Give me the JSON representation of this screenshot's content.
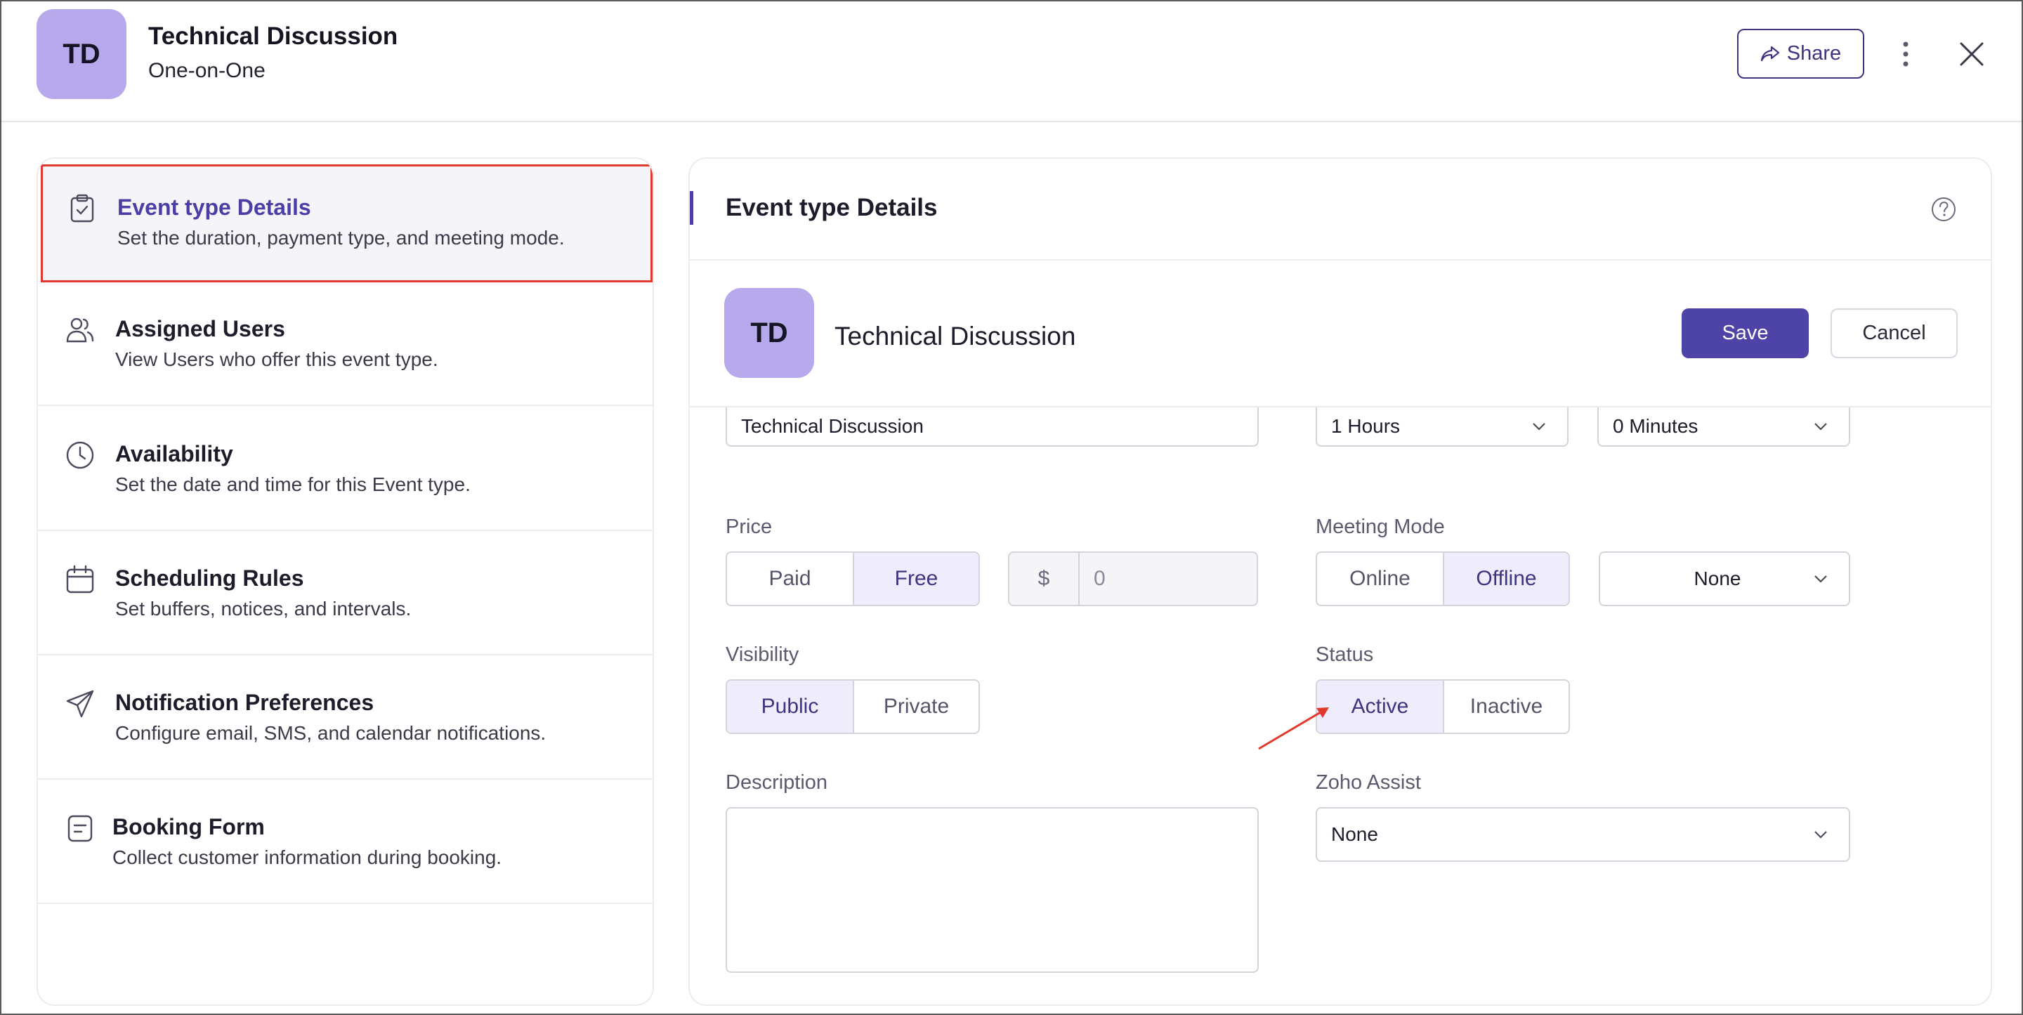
{
  "header": {
    "avatar_initials": "TD",
    "title": "Technical Discussion",
    "subtitle": "One-on-One",
    "share_label": "Share"
  },
  "sidebar": {
    "items": [
      {
        "title": "Event type Details",
        "desc": "Set the duration, payment type, and meeting mode.",
        "icon": "clipboard-check-icon",
        "active": true
      },
      {
        "title": "Assigned Users",
        "desc": "View Users who offer this event type.",
        "icon": "users-icon"
      },
      {
        "title": "Availability",
        "desc": "Set the date and time for this Event type.",
        "icon": "clock-icon"
      },
      {
        "title": "Scheduling Rules",
        "desc": "Set buffers, notices, and intervals.",
        "icon": "calendar-icon"
      },
      {
        "title": "Notification Preferences",
        "desc": "Configure email, SMS, and calendar notifications.",
        "icon": "paper-plane-icon"
      },
      {
        "title": "Booking Form",
        "desc": "Collect customer information during booking.",
        "icon": "form-icon"
      }
    ]
  },
  "panel": {
    "title": "Event type Details",
    "avatar_initials": "TD",
    "event_name": "Technical Discussion",
    "save_label": "Save",
    "cancel_label": "Cancel",
    "name_field_value": "Technical Discussion",
    "hours_value": "1 Hours",
    "minutes_value": "0 Minutes",
    "price": {
      "label": "Price",
      "options": [
        "Paid",
        "Free"
      ],
      "selected": "Free",
      "currency": "$",
      "amount_placeholder": "0"
    },
    "meeting_mode": {
      "label": "Meeting Mode",
      "options": [
        "Online",
        "Offline"
      ],
      "selected": "Offline",
      "location_value": "None"
    },
    "visibility": {
      "label": "Visibility",
      "options": [
        "Public",
        "Private"
      ],
      "selected": "Public"
    },
    "status": {
      "label": "Status",
      "options": [
        "Active",
        "Inactive"
      ],
      "selected": "Active"
    },
    "description": {
      "label": "Description",
      "value": ""
    },
    "zoho_assist": {
      "label": "Zoho Assist",
      "value": "None"
    }
  },
  "colors": {
    "accent": "#4e43a6",
    "selected_bg": "#efedfb",
    "avatar_bg": "#b8a9ec",
    "annotation_red": "#e0392d"
  }
}
